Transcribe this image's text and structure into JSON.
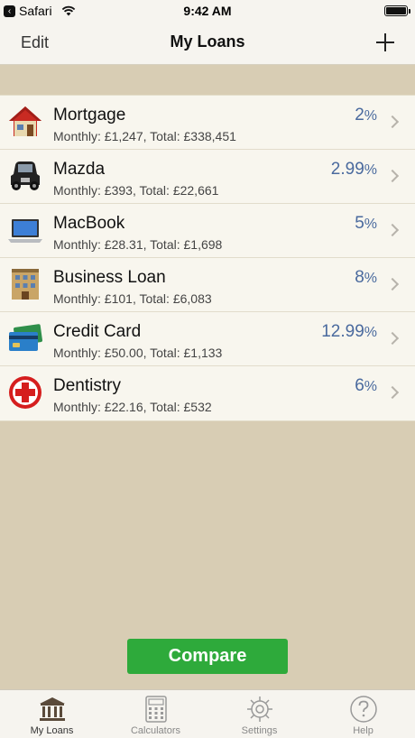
{
  "status_bar": {
    "back_app": "Safari",
    "time": "9:42 AM"
  },
  "nav": {
    "edit_label": "Edit",
    "title": "My Loans"
  },
  "loans": [
    {
      "name": "Mortgage",
      "rate": "2",
      "pct": "%",
      "summary": "Monthly: £1,247, Total: £338,451",
      "icon": "house-icon"
    },
    {
      "name": "Mazda",
      "rate": "2.99",
      "pct": "%",
      "summary": "Monthly: £393, Total: £22,661",
      "icon": "car-icon"
    },
    {
      "name": "MacBook",
      "rate": "5",
      "pct": "%",
      "summary": "Monthly: £28.31, Total: £1,698",
      "icon": "laptop-icon"
    },
    {
      "name": "Business Loan",
      "rate": "8",
      "pct": "%",
      "summary": "Monthly: £101, Total: £6,083",
      "icon": "building-icon"
    },
    {
      "name": "Credit Card",
      "rate": "12.99",
      "pct": "%",
      "summary": "Monthly: £50.00, Total: £1,133",
      "icon": "credit-card-icon"
    },
    {
      "name": "Dentistry",
      "rate": "6",
      "pct": "%",
      "summary": "Monthly: £22.16, Total: £532",
      "icon": "medical-cross-icon"
    }
  ],
  "compare_label": "Compare",
  "tabs": [
    {
      "label": "My Loans",
      "icon": "bank-icon",
      "active": true
    },
    {
      "label": "Calculators",
      "icon": "calculator-icon",
      "active": false
    },
    {
      "label": "Settings",
      "icon": "gear-icon",
      "active": false
    },
    {
      "label": "Help",
      "icon": "question-icon",
      "active": false
    }
  ],
  "colors": {
    "background": "#d8cdb4",
    "list_background": "#f8f6ee",
    "rate_text": "#4a6a9e",
    "compare_button": "#2eaa3b"
  }
}
